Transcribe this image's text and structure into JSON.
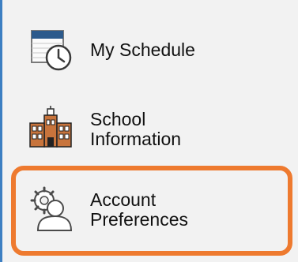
{
  "sidebar": {
    "items": [
      {
        "label_lines": [
          "My Schedule"
        ],
        "icon": "calendar-clock-icon"
      },
      {
        "label_lines": [
          "School",
          "Information"
        ],
        "icon": "school-building-icon"
      },
      {
        "label_lines": [
          "Account",
          "Preferences"
        ],
        "icon": "user-gear-icon",
        "highlighted": true
      }
    ]
  },
  "colors": {
    "sidebar_bg": "#f2f2f2",
    "edge_accent": "#3d7fc2",
    "highlight": "#ee7a2f"
  }
}
